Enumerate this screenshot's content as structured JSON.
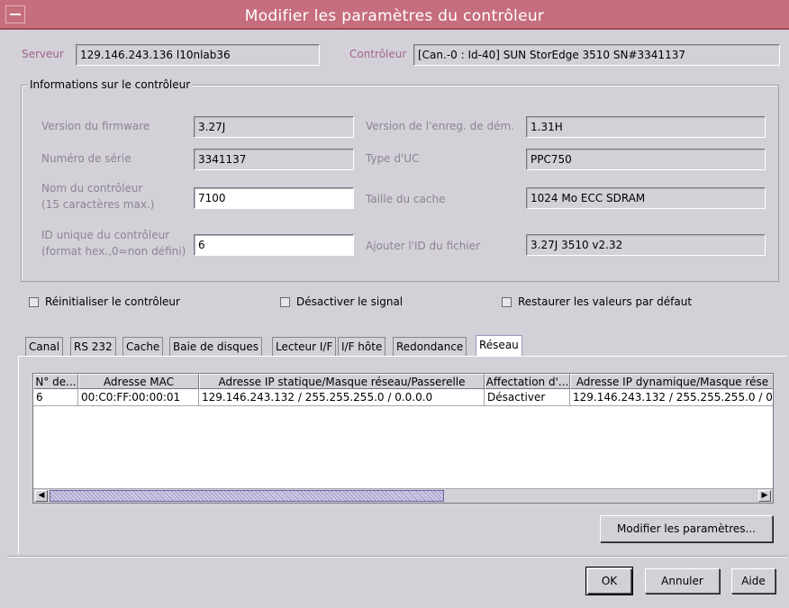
{
  "window": {
    "title": "Modifier les paramètres du contrôleur"
  },
  "header": {
    "server_label": "Serveur",
    "server_value": "129.146.243.136 l10nlab36",
    "controller_label": "Contrôleur",
    "controller_value": "[Can.-0 : Id-40] SUN StorEdge 3510 SN#3341137"
  },
  "info": {
    "group_title": "Informations sur le contrôleur",
    "firmware_label": "Version du firmware",
    "firmware_value": "3.27J",
    "boot_label": "Version de l'enreg. de dém.",
    "boot_value": "1.31H",
    "serial_label": "Numéro de série",
    "serial_value": "3341137",
    "cpu_label": "Type d'UC",
    "cpu_value": "PPC750",
    "name_label_1": "Nom du contrôleur",
    "name_label_2": "(15 caractères max.)",
    "name_value": "7100",
    "cache_label": "Taille du cache",
    "cache_value": "1024 Mo ECC SDRAM",
    "uid_label_1": "ID unique du contrôleur",
    "uid_label_2": "(format hex.,0=non défini)",
    "uid_value": "6",
    "fileid_label": "Ajouter l'ID du fichier",
    "fileid_value": "3.27J 3510 v2.32"
  },
  "options": {
    "reset_label": "Réinitialiser le contrôleur",
    "reset_checked": false,
    "disable_signal_label": "Désactiver le signal",
    "disable_signal_checked": false,
    "restore_label": "Restaurer les valeurs par défaut",
    "restore_checked": false
  },
  "tabs": [
    {
      "label": "Canal"
    },
    {
      "label": "RS 232"
    },
    {
      "label": "Cache"
    },
    {
      "label": "Baie de disques"
    },
    {
      "label": "Lecteur I/F"
    },
    {
      "label": "I/F hôte"
    },
    {
      "label": "Redondance"
    },
    {
      "label": "Réseau"
    }
  ],
  "active_tab": "Réseau",
  "network_table": {
    "columns": [
      "N° de...",
      "Adresse MAC",
      "Adresse IP statique/Masque réseau/Passerelle",
      "Affectation d'...",
      "Adresse IP dynamique/Masque rése"
    ],
    "rows": [
      [
        "6",
        "00:C0:FF:00:00:01",
        "129.146.243.132 / 255.255.255.0 / 0.0.0.0",
        "Désactiver",
        "129.146.243.132 / 255.255.255.0 / 0"
      ]
    ],
    "scroll_left_icon": "◀",
    "scroll_right_icon": "▶"
  },
  "buttons": {
    "modify_settings": "Modifier les paramètres...",
    "ok": "OK",
    "cancel": "Annuler",
    "help": "Aide"
  },
  "colors": {
    "titlebar": "#c76e7e",
    "label_pink": "#a0648c",
    "label_grey": "#8a8592",
    "background": "#d4d0d8"
  }
}
